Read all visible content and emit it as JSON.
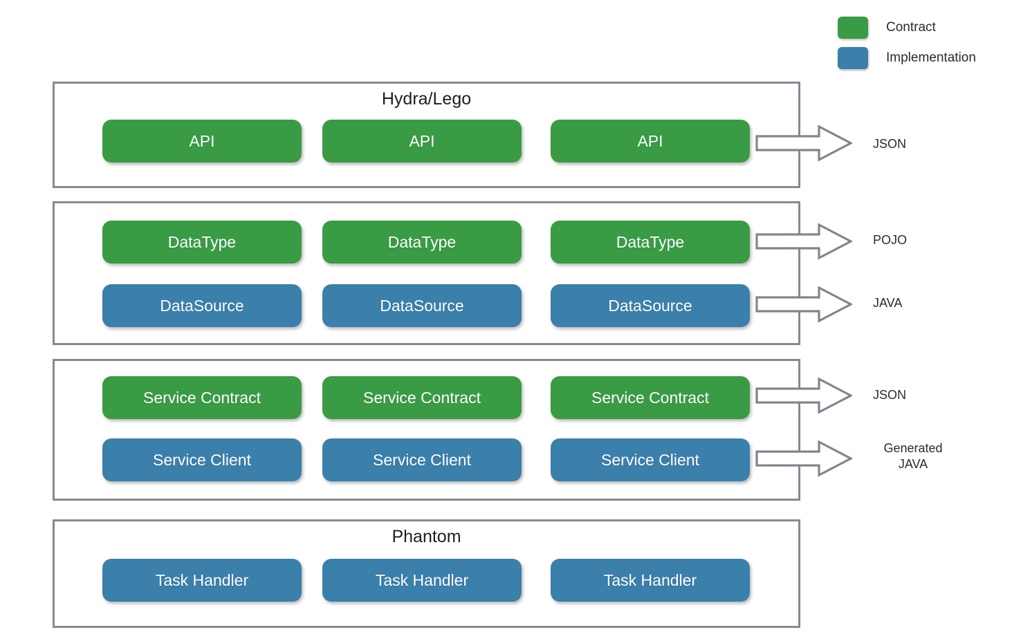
{
  "legend": {
    "items": [
      {
        "label": "Contract",
        "color": "#3a9b45",
        "swatch": "green"
      },
      {
        "label": "Implementation",
        "color": "#3b7fab",
        "swatch": "blue"
      }
    ]
  },
  "diagram": {
    "type": "layered-architecture",
    "columns": 3,
    "panels": [
      {
        "title": "Hydra/Lego",
        "rows": [
          {
            "kind": "Contract",
            "color": "#3a9b45",
            "nodes": [
              "API",
              "API",
              "API"
            ],
            "output": "JSON",
            "has_arrow": true
          }
        ]
      },
      {
        "title": "",
        "rows": [
          {
            "kind": "Contract",
            "color": "#3a9b45",
            "nodes": [
              "DataType",
              "DataType",
              "DataType"
            ],
            "output": "POJO",
            "has_arrow": true
          },
          {
            "kind": "Implementation",
            "color": "#3b7fab",
            "nodes": [
              "DataSource",
              "DataSource",
              "DataSource"
            ],
            "output": "JAVA",
            "has_arrow": true
          }
        ]
      },
      {
        "title": "",
        "rows": [
          {
            "kind": "Contract",
            "color": "#3a9b45",
            "nodes": [
              "Service Contract",
              "Service Contract",
              "Service Contract"
            ],
            "output": "JSON",
            "has_arrow": true
          },
          {
            "kind": "Implementation",
            "color": "#3b7fab",
            "nodes": [
              "Service Client",
              "Service Client",
              "Service Client"
            ],
            "output_line1": "Generated",
            "output_line2": "JAVA",
            "has_arrow": true
          }
        ]
      },
      {
        "title": "Phantom",
        "rows": [
          {
            "kind": "Implementation",
            "color": "#3b7fab",
            "nodes": [
              "Task Handler",
              "Task Handler",
              "Task Handler"
            ],
            "output": "",
            "has_arrow": false
          }
        ]
      }
    ]
  },
  "colors": {
    "contract_green": "#3a9b45",
    "implementation_blue": "#3b7fab",
    "panel_border": "#848a94",
    "arrow_stroke": "#80868f",
    "text": "#2b2b2b",
    "background": "#ffffff"
  }
}
